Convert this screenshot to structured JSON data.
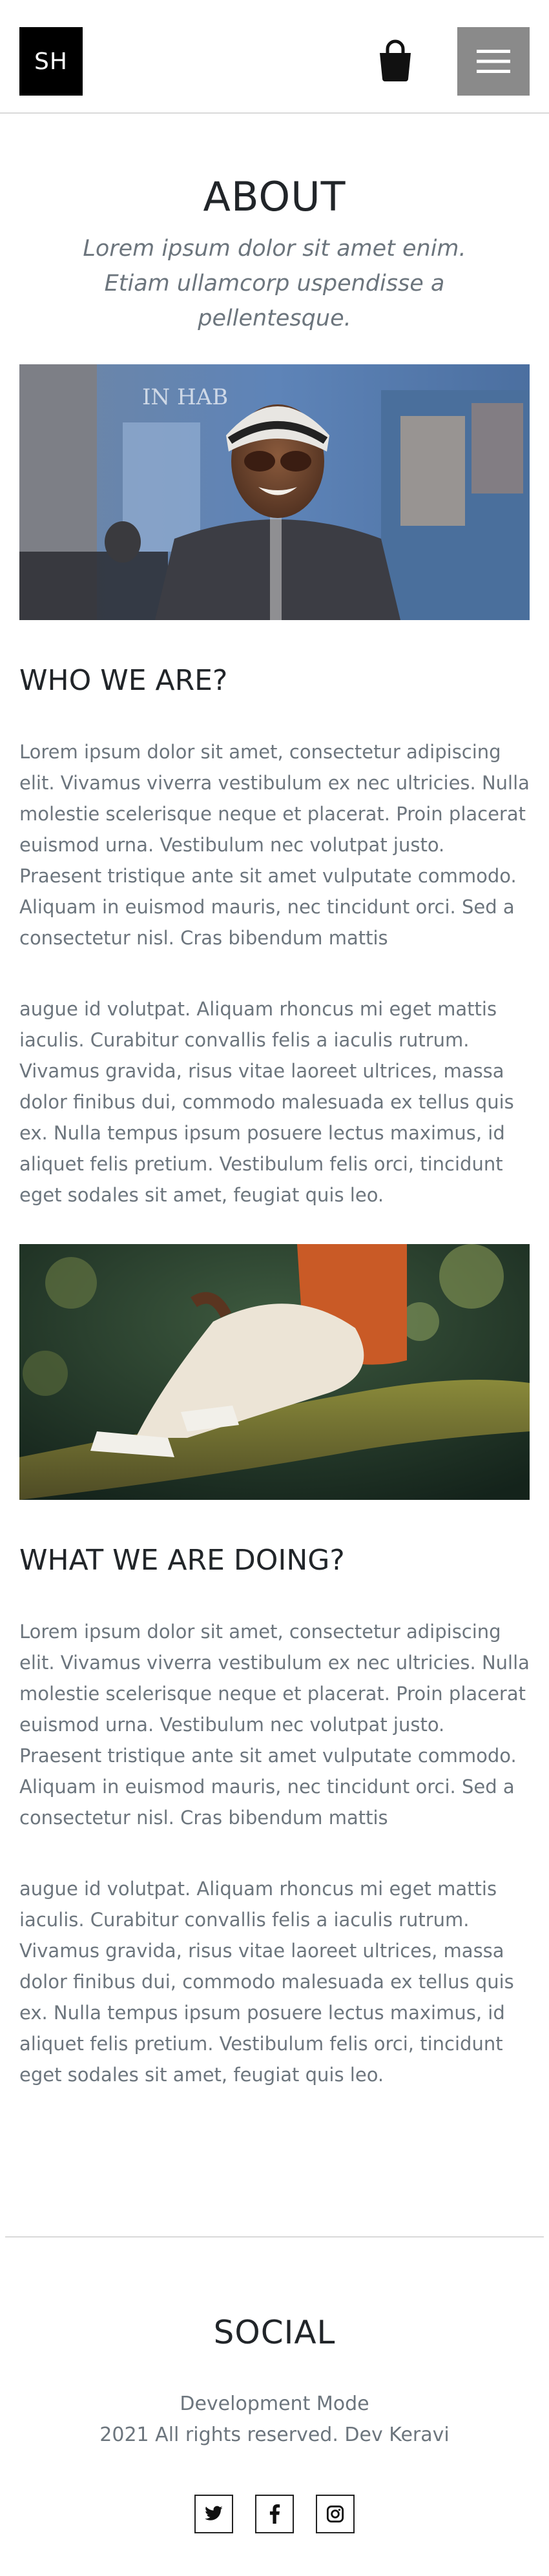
{
  "header": {
    "logo_text": "SH",
    "cart_icon": "shopping-bag-icon",
    "menu_icon": "hamburger-menu-icon"
  },
  "hero": {
    "title": "ABOUT",
    "subtitle": "Lorem ipsum dolor sit amet enim. Etiam ullamcorp uspendisse a pellentesque."
  },
  "sections": [
    {
      "title": "WHO WE ARE?",
      "paragraphs": [
        "Lorem ipsum dolor sit amet, consectetur adipiscing elit. Vivamus viverra vestibulum ex nec ultricies. Nulla molestie scelerisque neque et placerat. Proin placerat euismod urna. Vestibulum nec volutpat justo. Praesent tristique ante sit amet vulputate commodo. Aliquam in euismod mauris, nec tincidunt orci. Sed a consectetur nisl. Cras bibendum mattis",
        "augue id volutpat. Aliquam rhoncus mi eget mattis iaculis. Curabitur convallis felis a iaculis rutrum. Vivamus gravida, risus vitae laoreet ultrices, massa dolor finibus dui, commodo malesuada ex tellus quis ex. Nulla tempus ipsum posuere lectus maximus, id aliquet felis pretium. Vestibulum felis orci, tincidunt eget sodales sit amet, feugiat quis leo."
      ]
    },
    {
      "title": "WHAT WE ARE DOING?",
      "paragraphs": [
        "Lorem ipsum dolor sit amet, consectetur adipiscing elit. Vivamus viverra vestibulum ex nec ultricies. Nulla molestie scelerisque neque et placerat. Proin placerat euismod urna. Vestibulum nec volutpat justo. Praesent tristique ante sit amet vulputate commodo. Aliquam in euismod mauris, nec tincidunt orci. Sed a consectetur nisl. Cras bibendum mattis",
        "augue id volutpat. Aliquam rhoncus mi eget mattis iaculis. Curabitur convallis felis a iaculis rutrum. Vivamus gravida, risus vitae laoreet ultrices, massa dolor finibus dui, commodo malesuada ex tellus quis ex. Nulla tempus ipsum posuere lectus maximus, id aliquet felis pretium. Vestibulum felis orci, tincidunt eget sodales sit amet, feugiat quis leo."
      ]
    }
  ],
  "footer": {
    "title": "SOCIAL",
    "mode_text": "Development Mode",
    "rights_text": "2021 All rights reserved. Dev Keravi",
    "social_icons": [
      "twitter-icon",
      "facebook-icon",
      "instagram-icon"
    ]
  },
  "colors": {
    "logo_bg": "#000000",
    "menu_bg": "#8a8a8a",
    "heading": "#212529",
    "body_text": "#6c757d",
    "divider": "#d9d9d9"
  }
}
